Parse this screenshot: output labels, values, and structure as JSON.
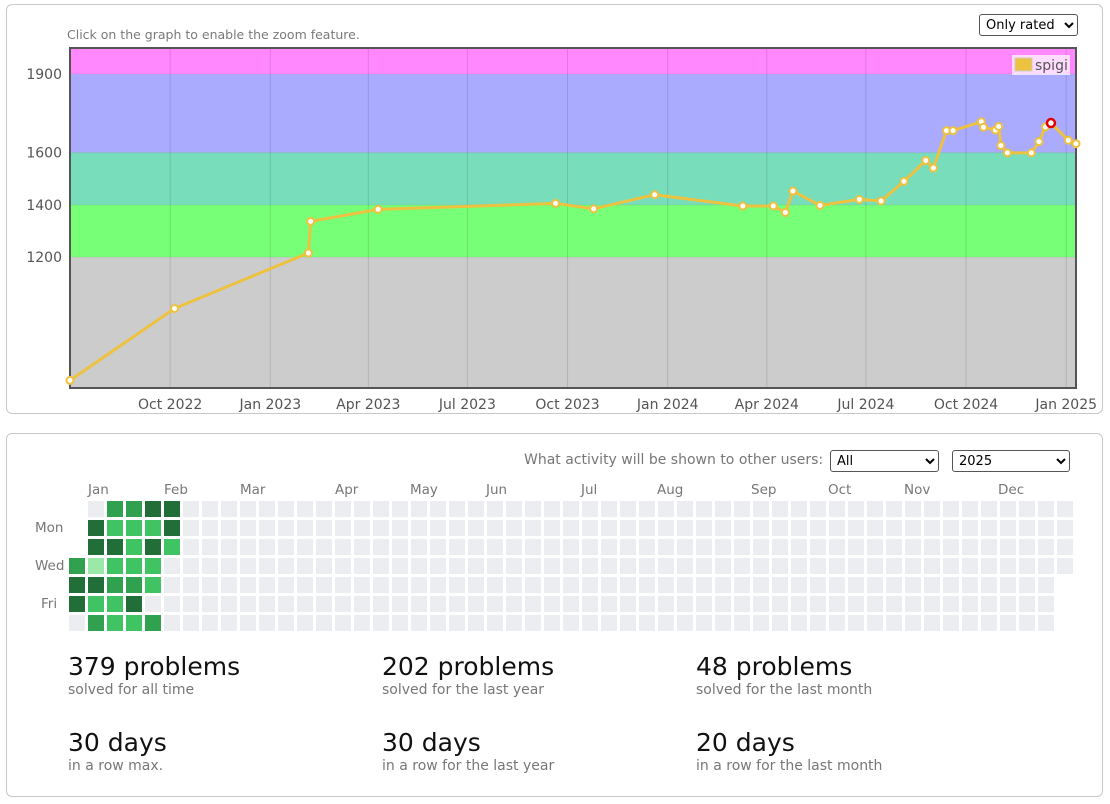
{
  "rating_panel": {
    "hint": "Click on the graph to enable the zoom feature.",
    "filter_select": {
      "value": "Only rated",
      "options": [
        "Only rated"
      ]
    }
  },
  "chart_data": {
    "type": "line",
    "legend": {
      "label": "spigi",
      "position": "top-right",
      "color": "#edc240"
    },
    "ylim": [
      700,
      2000
    ],
    "y_ticks": [
      1200,
      1400,
      1600,
      1900
    ],
    "x_ticks": [
      {
        "label": "Oct 2022",
        "date": "2022-10-01"
      },
      {
        "label": "Jan 2023",
        "date": "2023-01-01"
      },
      {
        "label": "Apr 2023",
        "date": "2023-04-01"
      },
      {
        "label": "Jul 2023",
        "date": "2023-07-01"
      },
      {
        "label": "Oct 2023",
        "date": "2023-10-01"
      },
      {
        "label": "Jan 2024",
        "date": "2024-01-01"
      },
      {
        "label": "Apr 2024",
        "date": "2024-04-01"
      },
      {
        "label": "Jul 2024",
        "date": "2024-07-01"
      },
      {
        "label": "Oct 2024",
        "date": "2024-10-01"
      },
      {
        "label": "Jan 2025",
        "date": "2025-01-01"
      }
    ],
    "xlim": [
      "2022-07-01",
      "2025-01-10"
    ],
    "bands": [
      {
        "from": 2000,
        "to": 1900,
        "color": "#ff88ff"
      },
      {
        "from": 1900,
        "to": 1600,
        "color": "#aaaaff"
      },
      {
        "from": 1600,
        "to": 1400,
        "color": "#77ddbb"
      },
      {
        "from": 1400,
        "to": 1200,
        "color": "#77ff77"
      },
      {
        "from": 1200,
        "to": 700,
        "color": "#cccccc"
      }
    ],
    "series": [
      {
        "name": "spigi",
        "color": "#edc240",
        "points": [
          [
            "2022-07-01",
            729
          ],
          [
            "2022-10-05",
            1004
          ],
          [
            "2023-02-05",
            1216
          ],
          [
            "2023-02-07",
            1337
          ],
          [
            "2023-04-10",
            1383
          ],
          [
            "2023-09-20",
            1406
          ],
          [
            "2023-10-25",
            1385
          ],
          [
            "2023-12-20",
            1439
          ],
          [
            "2024-03-10",
            1396
          ],
          [
            "2024-04-07",
            1396
          ],
          [
            "2024-04-18",
            1371
          ],
          [
            "2024-04-25",
            1453
          ],
          [
            "2024-05-20",
            1398
          ],
          [
            "2024-06-25",
            1421
          ],
          [
            "2024-07-15",
            1415
          ],
          [
            "2024-08-05",
            1490
          ],
          [
            "2024-08-25",
            1570
          ],
          [
            "2024-09-01",
            1541
          ],
          [
            "2024-09-13",
            1684
          ],
          [
            "2024-09-19",
            1684
          ],
          [
            "2024-10-15",
            1718
          ],
          [
            "2024-10-17",
            1697
          ],
          [
            "2024-10-28",
            1686
          ],
          [
            "2024-10-31",
            1700
          ],
          [
            "2024-11-02",
            1627
          ],
          [
            "2024-11-08",
            1599
          ],
          [
            "2024-11-30",
            1599
          ],
          [
            "2024-12-07",
            1642
          ],
          [
            "2024-12-13",
            1698
          ],
          [
            "2024-12-18",
            1713
          ],
          [
            "2025-01-03",
            1647
          ],
          [
            "2025-01-10",
            1634
          ]
        ],
        "highlight_index": 29
      }
    ]
  },
  "activity_panel": {
    "label": "What activity will be shown to other users:",
    "shown_select": {
      "value": "All",
      "options": [
        "All"
      ]
    },
    "year_select": {
      "value": "2025",
      "options": [
        "2025"
      ]
    },
    "months": [
      "Jan",
      "Feb",
      "Mar",
      "Apr",
      "May",
      "Jun",
      "Jul",
      "Aug",
      "Sep",
      "Oct",
      "Nov",
      "Dec"
    ],
    "days": [
      "Mon",
      "Wed",
      "Fri"
    ],
    "heatmap": {
      "weeks": 53,
      "colors": [
        "#ebedf0",
        "#9be9a8",
        "#40c463",
        "#30a14e",
        "#216e39"
      ],
      "first_week_start_row": 3,
      "active": [
        [
          0,
          [
            3,
            4,
            4
          ]
        ],
        [
          1,
          [
            0,
            4,
            4,
            1,
            4,
            2,
            3
          ]
        ],
        [
          2,
          [
            3,
            2,
            4,
            2,
            3,
            2,
            2
          ]
        ],
        [
          3,
          [
            3,
            2,
            2,
            2,
            3,
            4,
            2
          ]
        ],
        [
          4,
          [
            4,
            2,
            4,
            2,
            2,
            0,
            3
          ]
        ],
        [
          5,
          [
            4,
            4,
            2,
            0,
            0,
            0,
            0
          ]
        ]
      ]
    }
  },
  "stats": [
    {
      "value": "379 problems",
      "label": "solved for all time"
    },
    {
      "value": "202 problems",
      "label": "solved for the last year"
    },
    {
      "value": "48 problems",
      "label": "solved for the last month"
    },
    {
      "value": "30 days",
      "label": "in a row max."
    },
    {
      "value": "30 days",
      "label": "in a row for the last year"
    },
    {
      "value": "20 days",
      "label": "in a row for the last month"
    }
  ]
}
